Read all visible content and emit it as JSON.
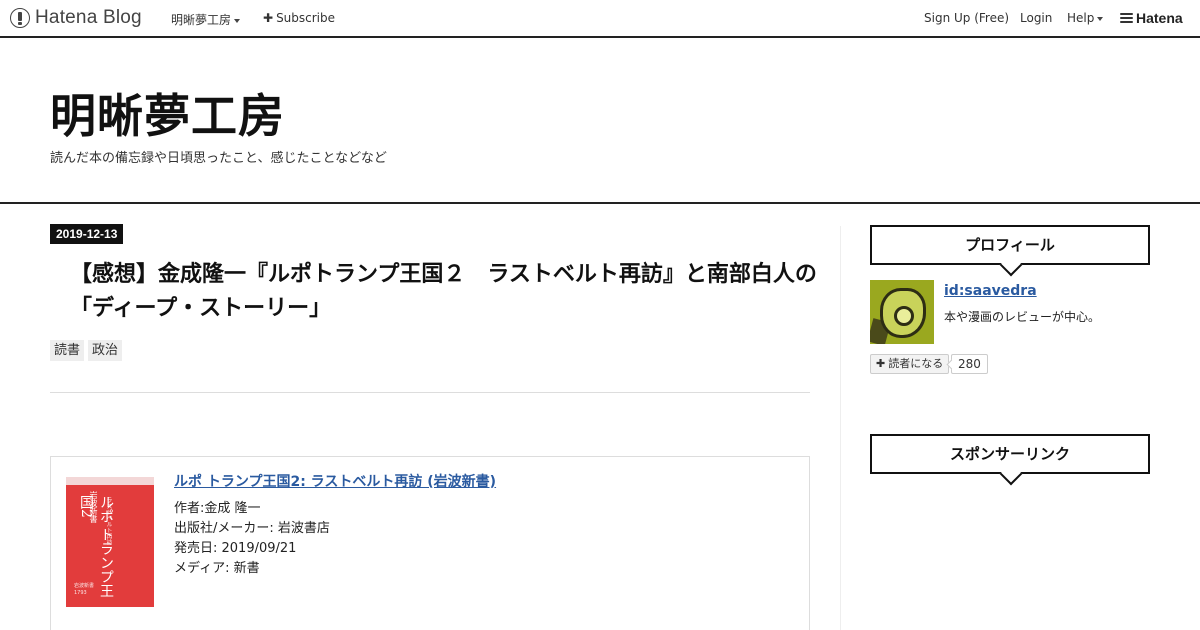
{
  "navbar": {
    "brand": "Hatena Blog",
    "blog_menu": "明晰夢工房",
    "subscribe": "Subscribe",
    "signup": "Sign Up (Free)",
    "login": "Login",
    "help": "Help",
    "hatena": "Hatena"
  },
  "blog": {
    "title": "明晰夢工房",
    "description": "読んだ本の備忘録や日頃思ったこと、感じたことなどなど"
  },
  "entry": {
    "date": "2019-12-13",
    "title": "【感想】金成隆一『ルポトランプ王国２　ラストベルト再訪』と南部白人の「ディープ・ストーリー」",
    "categories": [
      "読書",
      "政治"
    ]
  },
  "product": {
    "title": "ルポ トランプ王国2: ラストベルト再訪 (岩波新書)",
    "author": "作者:金成 隆一",
    "publisher": "出版社/メーカー: 岩波書店",
    "release_date": "発売日: 2019/09/21",
    "media": "メディア: 新書",
    "cover": {
      "series": "岩波新書",
      "main_title": "ルポ トランプ王国2",
      "subtitle": "ラストベルト再訪"
    }
  },
  "sidebar": {
    "profile_heading": "プロフィール",
    "user_id": "id:saavedra",
    "user_desc": "本や漫画のレビューが中心。",
    "subscribe_label": "読者になる",
    "subscriber_count": "280",
    "sponsor_heading": "スポンサーリンク"
  },
  "colors": {
    "link": "#2a5aa0",
    "cover_red": "#e23c3c",
    "accent_black": "#111111"
  }
}
